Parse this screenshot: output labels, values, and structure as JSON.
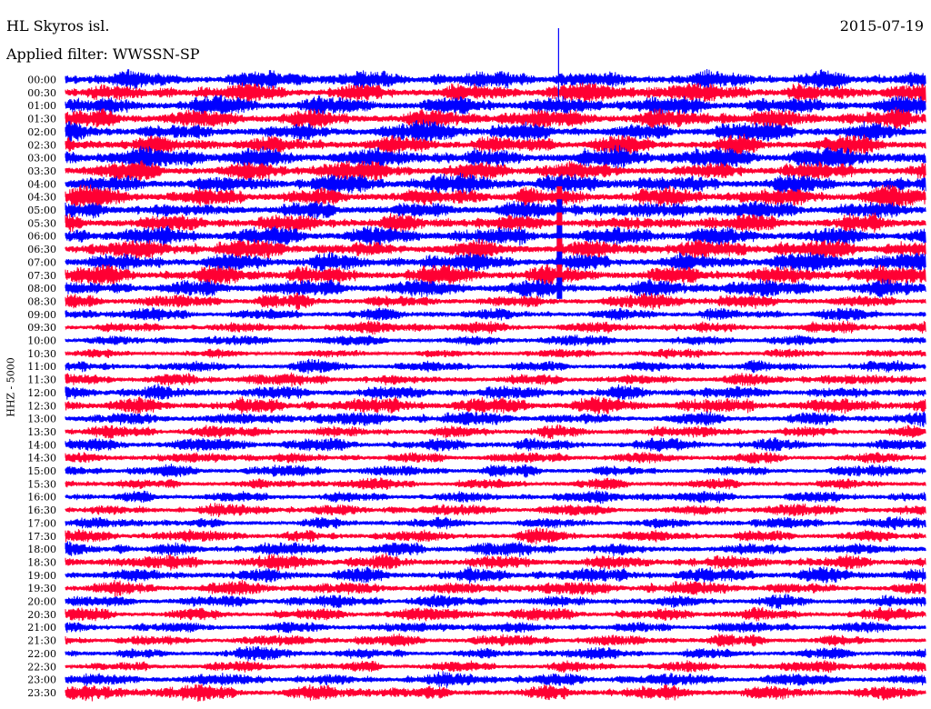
{
  "header": {
    "station": "HL Skyros isl.",
    "date": "2015-07-19",
    "filter_label": "Applied filter:",
    "filter_value": "WWSSN-SP"
  },
  "channel_label": "HHZ - 5000",
  "colors": {
    "trace_a": "#0000ff",
    "trace_b": "#ff0033",
    "background": "#ffffff",
    "text": "#000000"
  },
  "chart_data": {
    "type": "line",
    "title": "HL Skyros isl.",
    "subtitle": "Applied filter: WWSSN-SP",
    "ylabel": "HHZ - 5000",
    "row_labels": [
      "00:00",
      "00:30",
      "01:00",
      "01:30",
      "02:00",
      "02:30",
      "03:00",
      "03:30",
      "04:00",
      "04:30",
      "05:00",
      "05:30",
      "06:00",
      "06:30",
      "07:00",
      "07:30",
      "08:00",
      "08:30",
      "09:00",
      "09:30",
      "10:00",
      "10:30",
      "11:00",
      "11:30",
      "12:00",
      "12:30",
      "13:00",
      "13:30",
      "14:00",
      "14:30",
      "15:00",
      "15:30",
      "16:00",
      "16:30",
      "17:00",
      "17:30",
      "18:00",
      "18:30",
      "19:00",
      "19:30",
      "20:00",
      "20:30",
      "21:00",
      "21:30",
      "22:00",
      "22:30",
      "23:00",
      "23:30"
    ],
    "row_minutes": 30,
    "trace_colors_alternating": [
      "blue",
      "red"
    ],
    "row_noise_amplitude": [
      0.7,
      0.75,
      0.75,
      0.75,
      0.75,
      0.75,
      0.8,
      0.75,
      0.75,
      0.75,
      0.75,
      0.75,
      0.75,
      0.75,
      0.75,
      0.75,
      0.7,
      0.55,
      0.5,
      0.45,
      0.4,
      0.35,
      0.45,
      0.5,
      0.6,
      0.65,
      0.55,
      0.5,
      0.5,
      0.45,
      0.45,
      0.45,
      0.45,
      0.45,
      0.45,
      0.5,
      0.55,
      0.6,
      0.6,
      0.55,
      0.5,
      0.5,
      0.45,
      0.45,
      0.45,
      0.45,
      0.5,
      0.6
    ],
    "events": [
      {
        "row": "00:00",
        "minute_offset": 17.2,
        "peak_rows_up": 2,
        "description_visible": false
      },
      {
        "row": "04:30",
        "minute_offset": 17.2,
        "burst_rows": 8
      }
    ],
    "grid": false
  }
}
